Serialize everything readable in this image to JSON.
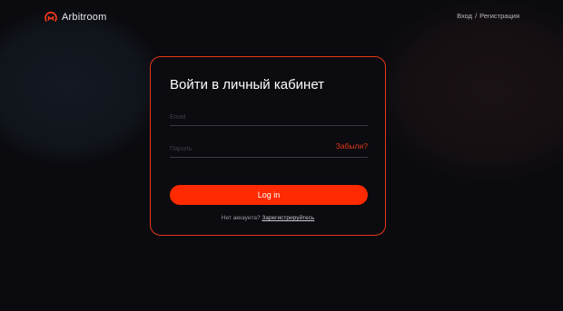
{
  "brand": {
    "name": "Arbitroom",
    "logo_icon": "arbitroom-logo-icon",
    "accent_color": "#ff2a00"
  },
  "nav": {
    "login_label": "Вход",
    "separator": "/",
    "register_label": "Регистрация"
  },
  "login_form": {
    "title": "Войти в личный кабинет",
    "email_placeholder": "Email",
    "email_value": "",
    "password_placeholder": "Пароль",
    "password_value": "",
    "forgot_label": "Забыли?",
    "submit_label": "Log in",
    "no_account_text": "Нет аккаунта?",
    "register_link_label": "Зарегистрируйтесь"
  }
}
